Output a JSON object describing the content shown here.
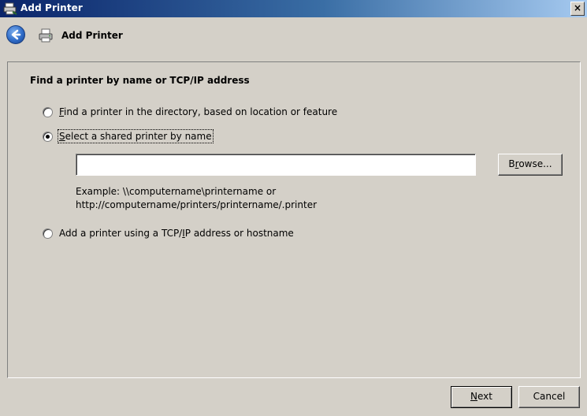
{
  "window": {
    "title": "Add Printer",
    "close_label": "×"
  },
  "header": {
    "title": "Add Printer",
    "back_icon": "back-arrow-icon",
    "printer_icon": "printer-icon"
  },
  "content": {
    "section_title": "Find a printer by name or TCP/IP address",
    "options": [
      {
        "label_pre": "",
        "label_mnemonic": "F",
        "label_post": "ind a printer in the directory, based on location or feature",
        "checked": false
      },
      {
        "label_pre": "",
        "label_mnemonic": "S",
        "label_post": "elect a shared printer by name",
        "checked": true
      },
      {
        "label_pre": "Add a printer using a TCP/",
        "label_mnemonic": "I",
        "label_post": "P address or hostname",
        "checked": false
      }
    ],
    "share_input": {
      "value": "",
      "placeholder": ""
    },
    "browse_label_pre": "B",
    "browse_label_mnemonic": "r",
    "browse_label_post": "owse...",
    "example_line1": "Example: \\\\computername\\printername or",
    "example_line2": "http://computername/printers/printername/.printer"
  },
  "footer": {
    "next_mnemonic": "N",
    "next_post": "ext",
    "cancel_label": "Cancel"
  },
  "colors": {
    "titlebar_start": "#0a246a",
    "titlebar_end": "#a6caf0",
    "window_bg": "#d4d0c8"
  }
}
